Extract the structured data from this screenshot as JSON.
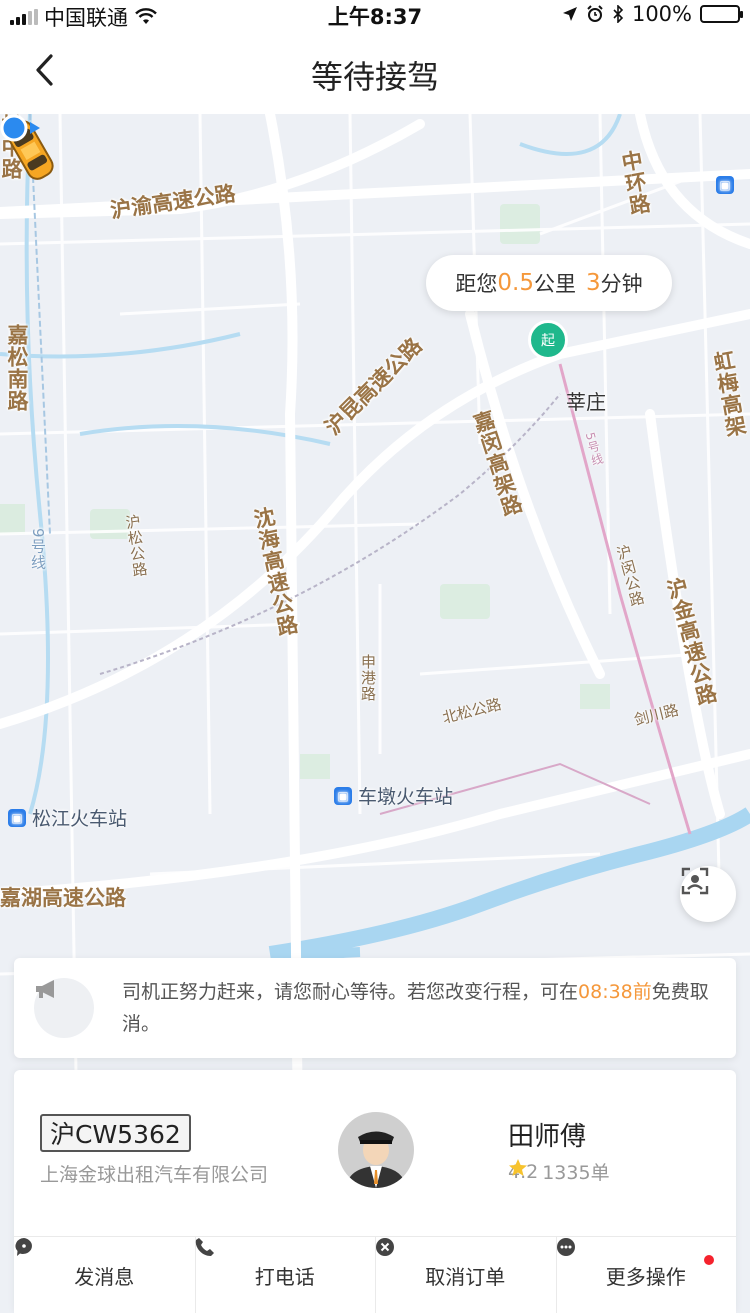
{
  "status_bar": {
    "carrier": "中国联通",
    "time": "上午8:37",
    "battery": "100%",
    "icons": [
      "signal-icon",
      "wifi-icon",
      "location-arrow-icon",
      "alarm-icon",
      "bluetooth-icon",
      "battery-icon"
    ]
  },
  "nav": {
    "title": "等待接驾",
    "back_icon": "chevron-left-icon"
  },
  "map": {
    "roads": [
      {
        "id": "huyu",
        "text": "沪渝高速公路"
      },
      {
        "id": "zhonghuan",
        "text": "中环路"
      },
      {
        "id": "jiasongnan",
        "text": "嘉松南路"
      },
      {
        "id": "songzhong",
        "text": "松中路"
      },
      {
        "id": "hongmei",
        "text": "虹梅高架"
      },
      {
        "id": "hukun",
        "text": "沪昆高速公路"
      },
      {
        "id": "jiamin",
        "text": "嘉闵高架路"
      },
      {
        "id": "husong",
        "text": "沪松公路"
      },
      {
        "id": "shenhai",
        "text": "沈海高速公路"
      },
      {
        "id": "humin",
        "text": "沪闵公路"
      },
      {
        "id": "hujin",
        "text": "沪金高速公路"
      },
      {
        "id": "shengang",
        "text": "申港路"
      },
      {
        "id": "beisong",
        "text": "北松公路"
      },
      {
        "id": "jianchuan",
        "text": "剑川路"
      },
      {
        "id": "jiahu",
        "text": "嘉湖高速公路"
      },
      {
        "id": "metro9",
        "text": "9号线"
      },
      {
        "id": "metro5",
        "text": "5号线"
      }
    ],
    "places": {
      "songjiang_station": "松江火车站",
      "chedun_station": "车墩火车站",
      "xinzhuang": "莘庄"
    },
    "eta": {
      "prefix": "距您",
      "distance": "0.5",
      "distance_unit": "公里",
      "minutes": "3",
      "minutes_unit": "分钟"
    },
    "pickup_pin_label": "起",
    "locate_icon": "locate-target-icon"
  },
  "notice": {
    "icon": "megaphone-icon",
    "text_before": "司机正努力赶来，请您耐心等待。若您改变行程，可在",
    "deadline": "08:38前",
    "text_after": "免费取消。"
  },
  "driver": {
    "plate": "沪CW5362",
    "company": "上海金球出租汽车有限公司",
    "name": "田师傅",
    "rating": "4.2",
    "orders": "1335单"
  },
  "actions": [
    {
      "id": "message",
      "label": "发消息",
      "icon": "message-bubble-icon"
    },
    {
      "id": "call",
      "label": "打电话",
      "icon": "phone-icon"
    },
    {
      "id": "cancel",
      "label": "取消订单",
      "icon": "cancel-circle-icon"
    },
    {
      "id": "more",
      "label": "更多操作",
      "icon": "more-dots-icon",
      "has_badge": true
    }
  ],
  "colors": {
    "accent": "#f5983b",
    "pin_green": "#1fb88c",
    "road_label": "#9a7446",
    "badge_red": "#f5222d"
  }
}
